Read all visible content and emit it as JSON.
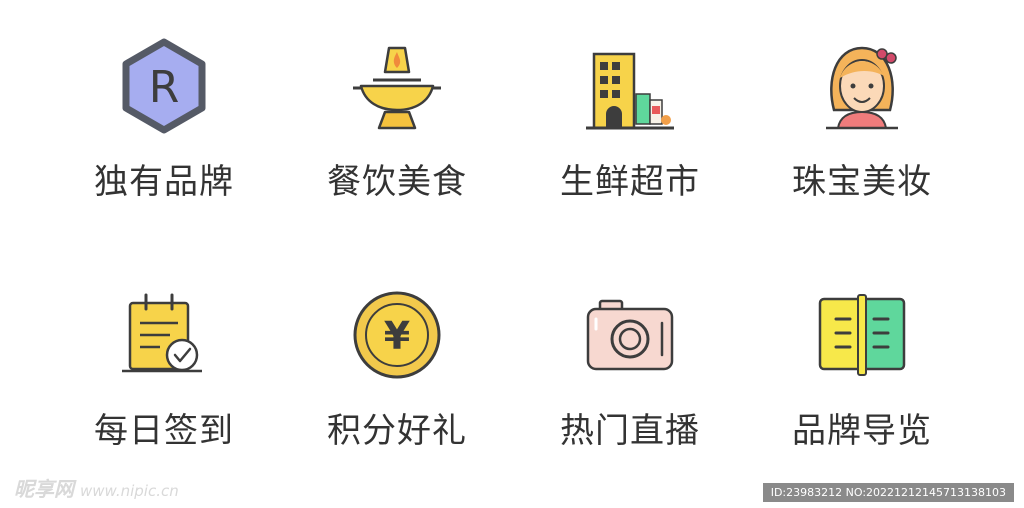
{
  "menu": {
    "row1": [
      {
        "label": "独有品牌",
        "icon": "brand-r-hexagon-icon"
      },
      {
        "label": "餐饮美食",
        "icon": "hotpot-icon"
      },
      {
        "label": "生鲜超市",
        "icon": "supermarket-building-icon"
      },
      {
        "label": "珠宝美妆",
        "icon": "girl-avatar-icon"
      }
    ],
    "row2": [
      {
        "label": "每日签到",
        "icon": "calendar-check-icon"
      },
      {
        "label": "积分好礼",
        "icon": "yuan-coin-icon"
      },
      {
        "label": "热门直播",
        "icon": "camera-icon"
      },
      {
        "label": "品牌导览",
        "icon": "open-book-icon"
      }
    ]
  },
  "watermark": {
    "left_brand": "昵享网",
    "left_site": "www.nipic.cn",
    "right_id": "ID:23983212 NO:20221212145713138103"
  },
  "colors": {
    "label_text": "#333333",
    "outline": "#3d3d3d",
    "yellow": "#f7d34a",
    "purple": "#a6adf0",
    "green": "#5fd79c",
    "pink": "#f7d8d0"
  }
}
